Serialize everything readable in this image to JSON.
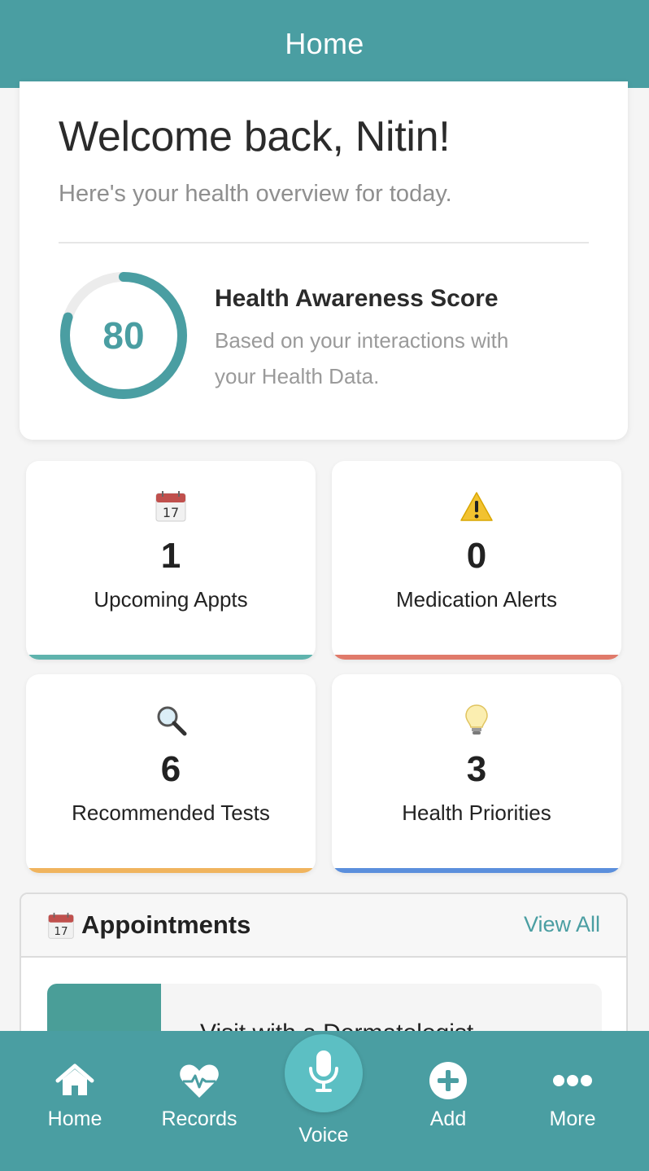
{
  "header": {
    "title": "Home"
  },
  "welcome": {
    "title": "Welcome back, Nitin!",
    "subtitle": "Here's your health overview for today."
  },
  "score": {
    "value": "80",
    "fraction": 0.8,
    "title": "Health Awareness Score",
    "description": "Based on your interactions with your Health Data."
  },
  "stats": [
    {
      "icon": "calendar-icon",
      "count": "1",
      "label": "Upcoming Appts",
      "accent": "#5fb3ad"
    },
    {
      "icon": "warning-icon",
      "count": "0",
      "label": "Medication Alerts",
      "accent": "#e07a6a"
    },
    {
      "icon": "magnifier-icon",
      "count": "6",
      "label": "Recommended Tests",
      "accent": "#f0b45e"
    },
    {
      "icon": "lightbulb-icon",
      "count": "3",
      "label": "Health Priorities",
      "accent": "#5b8fdc"
    }
  ],
  "appointments": {
    "title": "Appointments",
    "view_all": "View All",
    "first_item_title": "Visit with a Dermatologist"
  },
  "nav": {
    "home": "Home",
    "records": "Records",
    "voice": "Voice",
    "add": "Add",
    "more": "More"
  },
  "colors": {
    "primary": "#4a9ea2",
    "voice_button": "#5cbfc3"
  }
}
